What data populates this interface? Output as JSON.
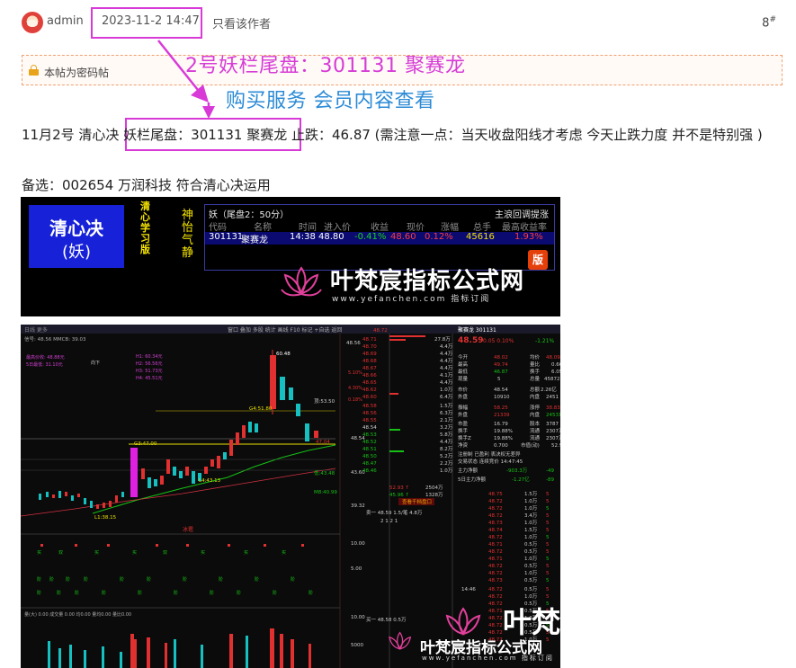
{
  "post": {
    "author": "admin",
    "timestamp": "2023-11-2 14:47",
    "only_author_link": "只看该作者",
    "floor": "8",
    "floor_mark": "#"
  },
  "notice": {
    "password_text": "本帖为密码帖"
  },
  "annotation": {
    "title": "2号妖栏尾盘：301131 聚赛龙",
    "subtitle": "购买服务  会员内容查看"
  },
  "content": {
    "line1_prefix": "11月2号 清心决 ",
    "line1_highlight": "妖栏尾盘：301131 聚赛龙",
    "line1_suffix": " 止跌：46.87 (需注意一点：当天收盘阳线才考虑  今天止跌力度 并不是特别强 )",
    "line2": "备选：002654 万润科技  符合清心决运用"
  },
  "banner": {
    "brand_title": "清心决",
    "brand_sub": "(妖)",
    "vertical_label": "清心学习版",
    "vertical_label2": "神怡气静",
    "panel_title": "妖（尾盘2：50分）",
    "panel_right": "主浪回调提涨",
    "columns": [
      "代码",
      "名称",
      "时间",
      "进入价",
      "收益",
      "现价",
      "涨幅",
      "总手",
      "最高收益率"
    ],
    "row": [
      "301131",
      "聚赛龙",
      "14:38",
      "48.80",
      "-0.41%",
      "48.60",
      "0.12%",
      "45616",
      "1.93%"
    ],
    "logo_text": "叶梵宸指标公式网",
    "logo_url": "www.yefanchen.com  指标订阅",
    "badge": "版"
  },
  "trade": {
    "stock_name": "聚赛龙 301131",
    "last_price": "48.59",
    "change": "0.05",
    "change_pct": "0.10%",
    "right_pct": "-1.21%",
    "price_labels": [
      "60.48",
      "53.50",
      "51.80",
      "47.00",
      "44.43.13",
      "43.48",
      "40.99",
      "38.15"
    ],
    "axis_labels": [
      "48.56",
      "48.54",
      "43.60",
      "39.32",
      "10.00",
      "5.00",
      "10.00",
      "5000"
    ],
    "order_book": [
      [
        "48.72",
        "1手"
      ],
      [
        "48.71",
        "27.8万"
      ],
      [
        "48.70",
        "4.4万"
      ],
      [
        "48.69",
        "4.4万"
      ],
      [
        "48.68",
        "4.4万"
      ],
      [
        "48.67",
        "4.4万"
      ],
      [
        "48.66",
        "4.1万"
      ],
      [
        "48.65",
        "4.4万"
      ],
      [
        "48.62",
        "1.0万"
      ],
      [
        "48.60",
        "6.4万"
      ],
      [
        "48.58",
        "1.5万"
      ],
      [
        "48.56",
        "6.3万"
      ],
      [
        "48.55",
        "2.1万"
      ],
      [
        "48.54",
        "3.2万"
      ],
      [
        "48.53",
        "5.8万"
      ],
      [
        "48.52",
        "4.4万"
      ],
      [
        "48.51",
        "8.2万"
      ],
      [
        "48.50",
        "5.2万"
      ],
      [
        "48.47",
        "2.2万"
      ],
      [
        "48.46",
        "1.0万"
      ]
    ],
    "quote_rows": [
      [
        "今开",
        "48.02",
        "均价",
        "48.09"
      ],
      [
        "最高",
        "49.74",
        "量比",
        "0.66"
      ],
      [
        "最低",
        "46.87",
        "换手",
        "6.05"
      ],
      [
        "现量",
        "5",
        "总量",
        "45872"
      ],
      [
        "外盘",
        "48.54",
        "内盘",
        "2.26亿"
      ],
      [
        "内盘",
        "10910",
        "外盘",
        "2451"
      ]
    ],
    "watermark": "叶梵宸指标公式网",
    "watermark_url": "www.yefanchen.com  指标订阅",
    "time_label": "14:46",
    "buy_sell": [
      "卖一",
      "48.59",
      "1.5/笔",
      "4.8万"
    ]
  }
}
